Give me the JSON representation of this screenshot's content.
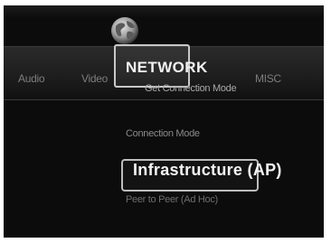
{
  "menu": {
    "tabs": [
      {
        "label": "Audio"
      },
      {
        "label": "Video"
      },
      {
        "label": "NETWORK",
        "active": true,
        "icon": "globe-icon"
      },
      {
        "label": "MISC"
      }
    ],
    "subtitle": "Get Connection Mode"
  },
  "settings": {
    "section_label": "Connection Mode",
    "options": [
      {
        "label": "Infrastructure (AP)",
        "selected": true
      },
      {
        "label": "Peer to Peer (Ad Hoc)",
        "selected": false
      }
    ]
  },
  "colors": {
    "background": "#0c0c0c",
    "text_active": "#f2f2f2",
    "text_dim": "#7d7d7d"
  }
}
